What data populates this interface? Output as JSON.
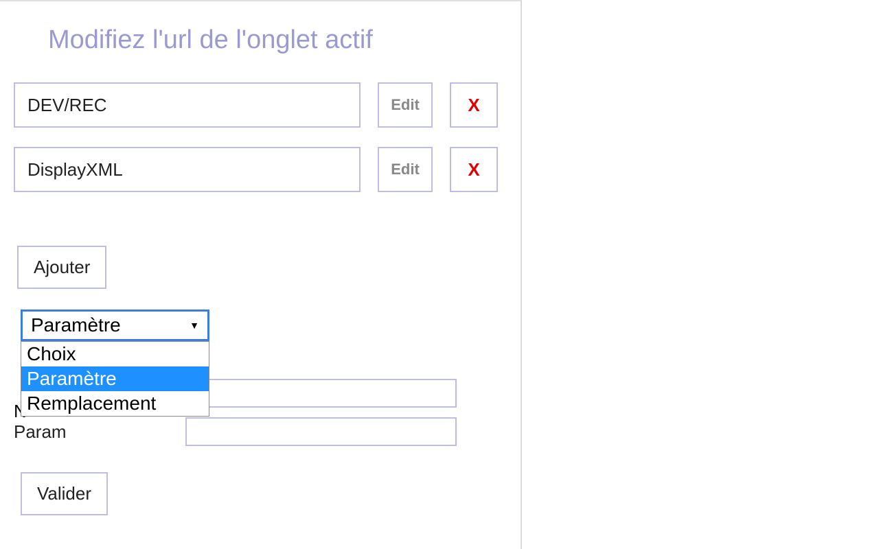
{
  "title": "Modifiez l'url de l'onglet actif",
  "entries": [
    {
      "value": "DEV/REC",
      "edit": "Edit",
      "delete": "X"
    },
    {
      "value": "DisplayXML",
      "edit": "Edit",
      "delete": "X"
    }
  ],
  "buttons": {
    "add": "Ajouter",
    "validate": "Valider"
  },
  "select": {
    "current": "Paramètre",
    "options": [
      "Choix",
      "Paramètre",
      "Remplacement"
    ],
    "selected_index": 1
  },
  "form": {
    "hidden_label_char": "N",
    "param_label": "Param",
    "hidden_value": "",
    "param_value": ""
  }
}
